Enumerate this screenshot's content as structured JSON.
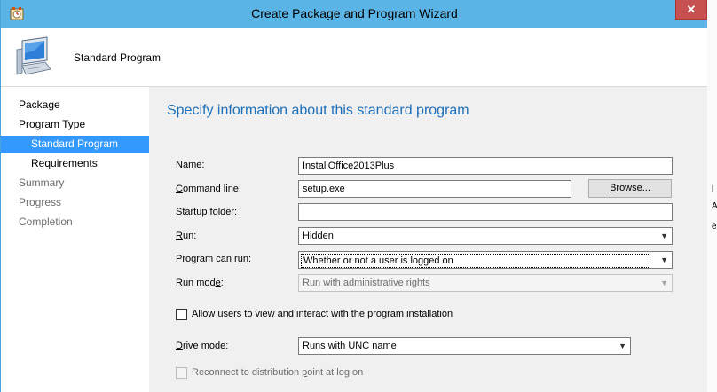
{
  "window": {
    "title": "Create Package and Program Wizard",
    "close_glyph": "✕",
    "icon": "wizard-app-icon"
  },
  "header": {
    "title": "Standard Program",
    "icon": "computer-icon"
  },
  "nav": {
    "items": [
      {
        "label": "Package",
        "state": "normal"
      },
      {
        "label": "Program Type",
        "state": "normal"
      },
      {
        "label": "Standard Program",
        "state": "active"
      },
      {
        "label": "Requirements",
        "state": "normal"
      },
      {
        "label": "Summary",
        "state": "disabled"
      },
      {
        "label": "Progress",
        "state": "disabled"
      },
      {
        "label": "Completion",
        "state": "disabled"
      }
    ]
  },
  "content": {
    "heading": "Specify information about this standard program",
    "name": {
      "label_pre": "N",
      "label_ul": "a",
      "label_post": "me:",
      "value": "InstallOffice2013Plus"
    },
    "command_line": {
      "label_pre": "",
      "label_ul": "C",
      "label_post": "ommand line:",
      "value": "setup.exe"
    },
    "browse_button": {
      "label_pre": "",
      "label_ul": "B",
      "label_post": "rowse..."
    },
    "startup_folder": {
      "label_pre": "",
      "label_ul": "S",
      "label_post": "tartup folder:",
      "value": ""
    },
    "run": {
      "label_pre": "",
      "label_ul": "R",
      "label_post": "un:",
      "value": "Hidden"
    },
    "program_can_run": {
      "label_pre": "Program can r",
      "label_ul": "u",
      "label_post": "n:",
      "value": "Whether or not a user is logged on"
    },
    "run_mode": {
      "label_pre": "Run mod",
      "label_ul": "e",
      "label_post": ":",
      "value": "Run with administrative rights"
    },
    "allow_interact": {
      "label_pre": "",
      "label_ul": "A",
      "label_post": "llow users to view and interact with the program installation",
      "checked": false
    },
    "drive_mode": {
      "label_pre": "",
      "label_ul": "D",
      "label_post": "rive mode:",
      "value": "Runs with UNC name"
    },
    "reconnect": {
      "label_pre": "Reconnect to distribution ",
      "label_ul": "p",
      "label_post": "oint at log on",
      "checked": false
    }
  },
  "edge": {
    "chars": [
      "l",
      "A",
      "e"
    ]
  },
  "colors": {
    "titlebar": "#5ab4e6",
    "heading": "#1e6fb8",
    "nav_active": "#3399ff",
    "close": "#c75050"
  }
}
